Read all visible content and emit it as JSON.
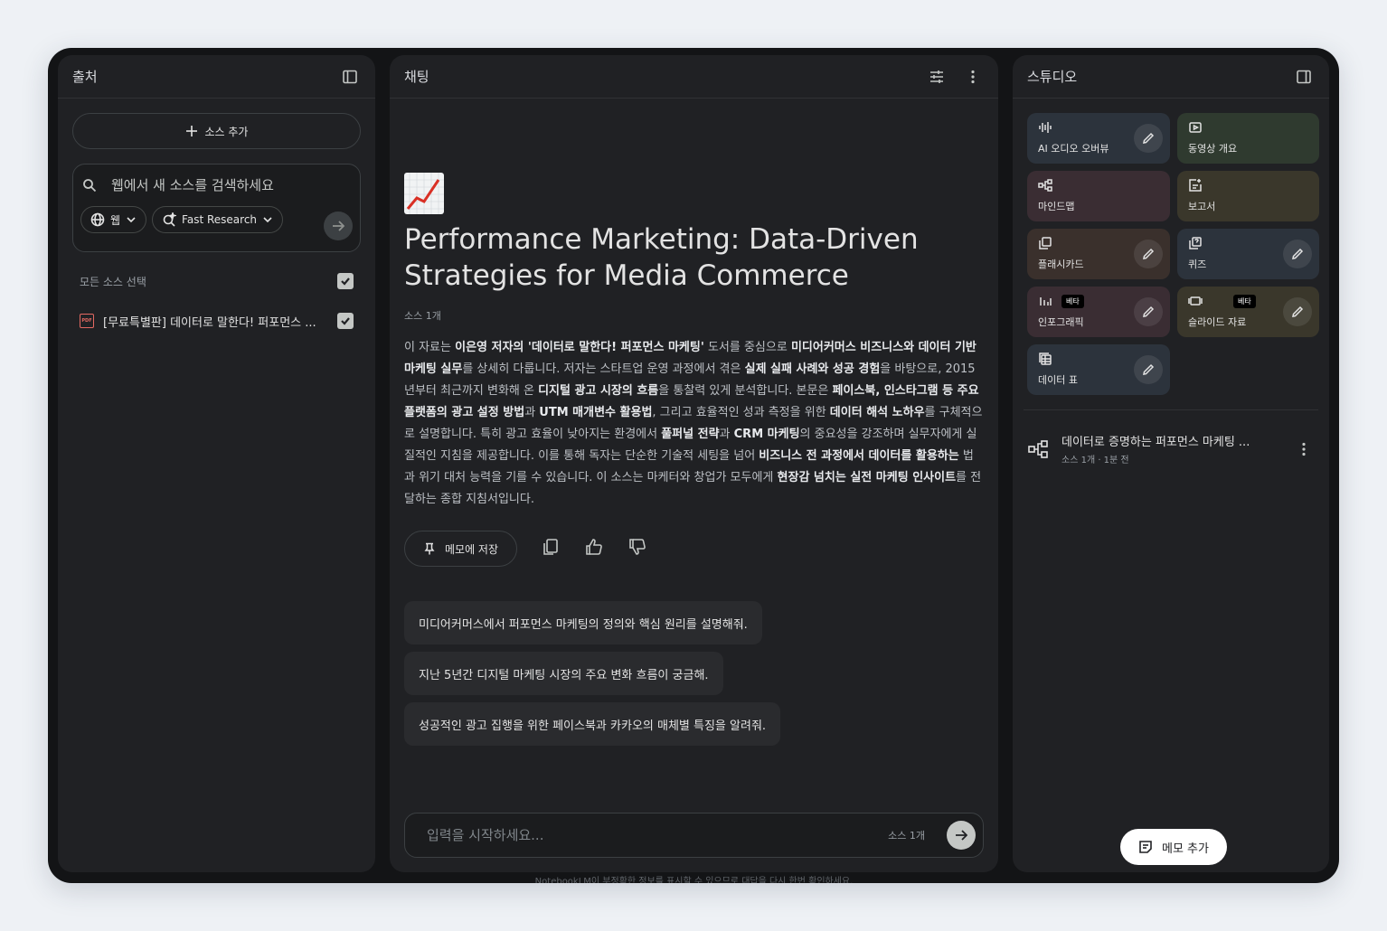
{
  "sources": {
    "title": "출처",
    "add_label": "소스 추가",
    "search_placeholder": "웹에서 새 소스를 검색하세요",
    "web_chip": "웹",
    "research_chip": "Fast Research",
    "select_all": "모든 소스 선택",
    "items": [
      {
        "name": "[무료특별판] 데이터로 말한다! 퍼포먼스 ...",
        "type": "pdf-icon",
        "checked": true
      }
    ]
  },
  "chat": {
    "title": "채팅",
    "emoji": "chart-increasing-icon",
    "doc_title_line1": "Performance Marketing: Data-Driven",
    "doc_title_line2": "Strategies for Media Commerce",
    "source_count": "소스 1개",
    "summary_html": "이 자료는 <b>이은영 저자의 '데이터로 말한다! 퍼포먼스 마케팅'</b> 도서를 중심으로 <b>미디어커머스 비즈니스와 데이터 기반 마케팅 실무</b>를 상세히 다룹니다. 저자는 스타트업 운영 과정에서 겪은 <b>실제 실패 사례와 성공 경험</b>을 바탕으로, 2015년부터 최근까지 변화해 온 <b>디지털 광고 시장의 흐름</b>을 통찰력 있게 분석합니다. 본문은 <b>페이스북, 인스타그램 등 주요 플랫폼의 광고 설정 방법</b>과 <b>UTM 매개변수 활용법</b>, 그리고 효율적인 성과 측정을 위한 <b>데이터 해석 노하우</b>를 구체적으로 설명합니다. 특히 광고 효율이 낮아지는 환경에서 <b>풀퍼널 전략</b>과 <b>CRM 마케팅</b>의 중요성을 강조하며 실무자에게 실질적인 지침을 제공합니다. 이를 통해 독자는 단순한 기술적 세팅을 넘어 <b>비즈니스 전 과정에서 데이터를 활용하는</b> 법과 위기 대처 능력을 기를 수 있습니다. 이 소스는 마케터와 창업가 모두에게 <b>현장감 넘치는 실전 마케팅 인사이트</b>를 전달하는 종합 지침서입니다.",
    "save_memo": "메모에 저장",
    "suggestions": [
      "미디어커머스에서 퍼포먼스 마케팅의 정의와 핵심 원리를 설명해줘.",
      "지난 5년간 디지털 마케팅 시장의 주요 변화 흐름이 궁금해.",
      "성공적인 광고 집행을 위한 페이스북과 카카오의 매체별 특징을 알려줘."
    ],
    "input_placeholder": "입력을 시작하세요...",
    "input_source_count": "소스 1개",
    "disclaimer": "NotebookLM이 부정확한 정보를 표시할 수 있으므로 대답을 다시 한번 확인하세요."
  },
  "studio": {
    "title": "스튜디오",
    "tiles": [
      {
        "label": "AI 오디오 오버뷰",
        "icon": "audio-waveform-icon",
        "editable": true,
        "beta": false
      },
      {
        "label": "동영상 개요",
        "icon": "video-icon",
        "editable": false,
        "beta": false
      },
      {
        "label": "마인드맵",
        "icon": "mindmap-icon",
        "editable": false,
        "beta": false
      },
      {
        "label": "보고서",
        "icon": "report-icon",
        "editable": false,
        "beta": false
      },
      {
        "label": "플래시카드",
        "icon": "flashcard-icon",
        "editable": true,
        "beta": false
      },
      {
        "label": "퀴즈",
        "icon": "quiz-icon",
        "editable": true,
        "beta": false
      },
      {
        "label": "인포그래픽",
        "icon": "infographic-icon",
        "editable": true,
        "beta": true
      },
      {
        "label": "슬라이드 자료",
        "icon": "slides-icon",
        "editable": true,
        "beta": true
      },
      {
        "label": "데이터 표",
        "icon": "data-table-icon",
        "editable": true,
        "beta": false
      }
    ],
    "beta_label": "베타",
    "note": {
      "title": "데이터로 증명하는 퍼포먼스 마케팅 ...",
      "meta": "소스 1개 · 1분 전"
    },
    "memo_add": "메모 추가"
  }
}
